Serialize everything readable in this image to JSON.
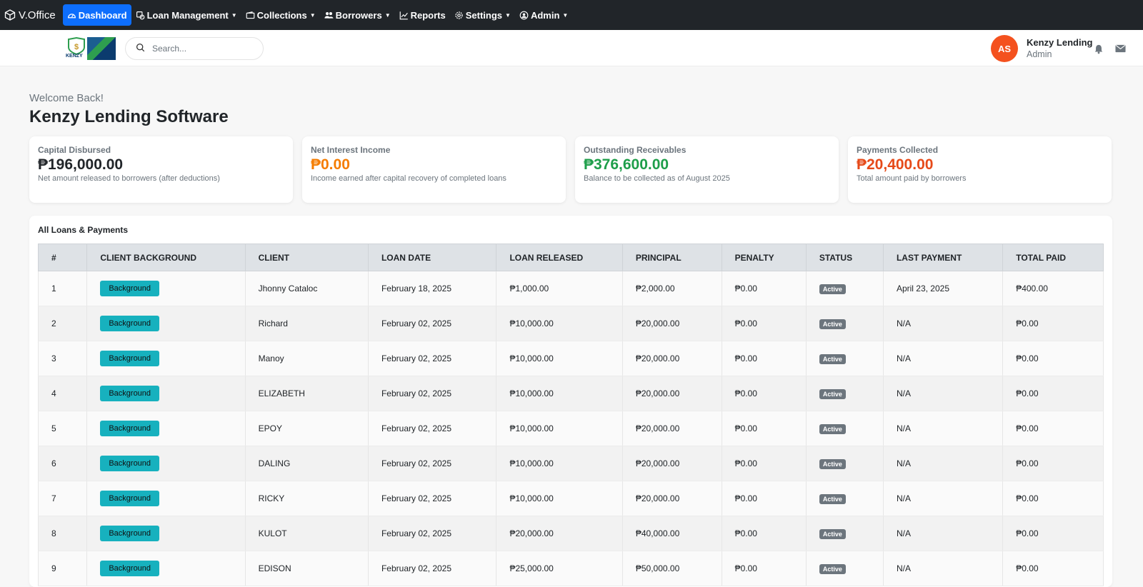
{
  "nav": {
    "brand": "V.Office",
    "items": [
      {
        "label": "Dashboard",
        "icon": "dashboard-icon"
      },
      {
        "label": "Loan Management",
        "icon": "loan-icon"
      },
      {
        "label": "Collections",
        "icon": "wallet-icon"
      },
      {
        "label": "Borrowers",
        "icon": "people-icon"
      },
      {
        "label": "Reports",
        "icon": "chart-icon"
      },
      {
        "label": "Settings",
        "icon": "gear-icon"
      },
      {
        "label": "Admin",
        "icon": "user-circle-icon"
      }
    ]
  },
  "header": {
    "logo_text": "KENZY",
    "search_placeholder": "Search...",
    "avatar_initials": "AS",
    "user_name": "Kenzy Lending",
    "user_role": "Admin"
  },
  "welcome": {
    "greeting": "Welcome Back!",
    "title": "Kenzy Lending Software"
  },
  "cards": [
    {
      "label": "Capital Disbursed",
      "value": "₱196,000.00",
      "desc": "Net amount released to borrowers (after deductions)",
      "color": "#212529"
    },
    {
      "label": "Net Interest Income",
      "value": "₱0.00",
      "desc": "Income earned after capital recovery of completed loans",
      "color": "#f57c00"
    },
    {
      "label": "Outstanding Receivables",
      "value": "₱376,600.00",
      "desc": "Balance to be collected as of August 2025",
      "color": "#1e9e4a"
    },
    {
      "label": "Payments Collected",
      "value": "₱20,400.00",
      "desc": "Total amount paid by borrowers",
      "color": "#e64a19"
    }
  ],
  "table": {
    "title": "All Loans & Payments",
    "columns": [
      "#",
      "CLIENT BACKGROUND",
      "CLIENT",
      "LOAN DATE",
      "LOAN RELEASED",
      "PRINCIPAL",
      "PENALTY",
      "STATUS",
      "LAST PAYMENT",
      "TOTAL PAID"
    ],
    "rows": [
      {
        "n": "1",
        "bg": "Background",
        "client": "Jhonny Cataloc",
        "date": "February 18, 2025",
        "released": "₱1,000.00",
        "principal": "₱2,000.00",
        "penalty": "₱0.00",
        "status": "Active",
        "last": "April 23, 2025",
        "paid": "₱400.00"
      },
      {
        "n": "2",
        "bg": "Background",
        "client": "Richard",
        "date": "February 02, 2025",
        "released": "₱10,000.00",
        "principal": "₱20,000.00",
        "penalty": "₱0.00",
        "status": "Active",
        "last": "N/A",
        "paid": "₱0.00"
      },
      {
        "n": "3",
        "bg": "Background",
        "client": "Manoy",
        "date": "February 02, 2025",
        "released": "₱10,000.00",
        "principal": "₱20,000.00",
        "penalty": "₱0.00",
        "status": "Active",
        "last": "N/A",
        "paid": "₱0.00"
      },
      {
        "n": "4",
        "bg": "Background",
        "client": "ELIZABETH",
        "date": "February 02, 2025",
        "released": "₱10,000.00",
        "principal": "₱20,000.00",
        "penalty": "₱0.00",
        "status": "Active",
        "last": "N/A",
        "paid": "₱0.00"
      },
      {
        "n": "5",
        "bg": "Background",
        "client": "EPOY",
        "date": "February 02, 2025",
        "released": "₱10,000.00",
        "principal": "₱20,000.00",
        "penalty": "₱0.00",
        "status": "Active",
        "last": "N/A",
        "paid": "₱0.00"
      },
      {
        "n": "6",
        "bg": "Background",
        "client": "DALING",
        "date": "February 02, 2025",
        "released": "₱10,000.00",
        "principal": "₱20,000.00",
        "penalty": "₱0.00",
        "status": "Active",
        "last": "N/A",
        "paid": "₱0.00"
      },
      {
        "n": "7",
        "bg": "Background",
        "client": "RICKY",
        "date": "February 02, 2025",
        "released": "₱10,000.00",
        "principal": "₱20,000.00",
        "penalty": "₱0.00",
        "status": "Active",
        "last": "N/A",
        "paid": "₱0.00"
      },
      {
        "n": "8",
        "bg": "Background",
        "client": "KULOT",
        "date": "February 02, 2025",
        "released": "₱20,000.00",
        "principal": "₱40,000.00",
        "penalty": "₱0.00",
        "status": "Active",
        "last": "N/A",
        "paid": "₱0.00"
      },
      {
        "n": "9",
        "bg": "Background",
        "client": "EDISON",
        "date": "February 02, 2025",
        "released": "₱25,000.00",
        "principal": "₱50,000.00",
        "penalty": "₱0.00",
        "status": "Active",
        "last": "N/A",
        "paid": "₱0.00"
      }
    ]
  }
}
